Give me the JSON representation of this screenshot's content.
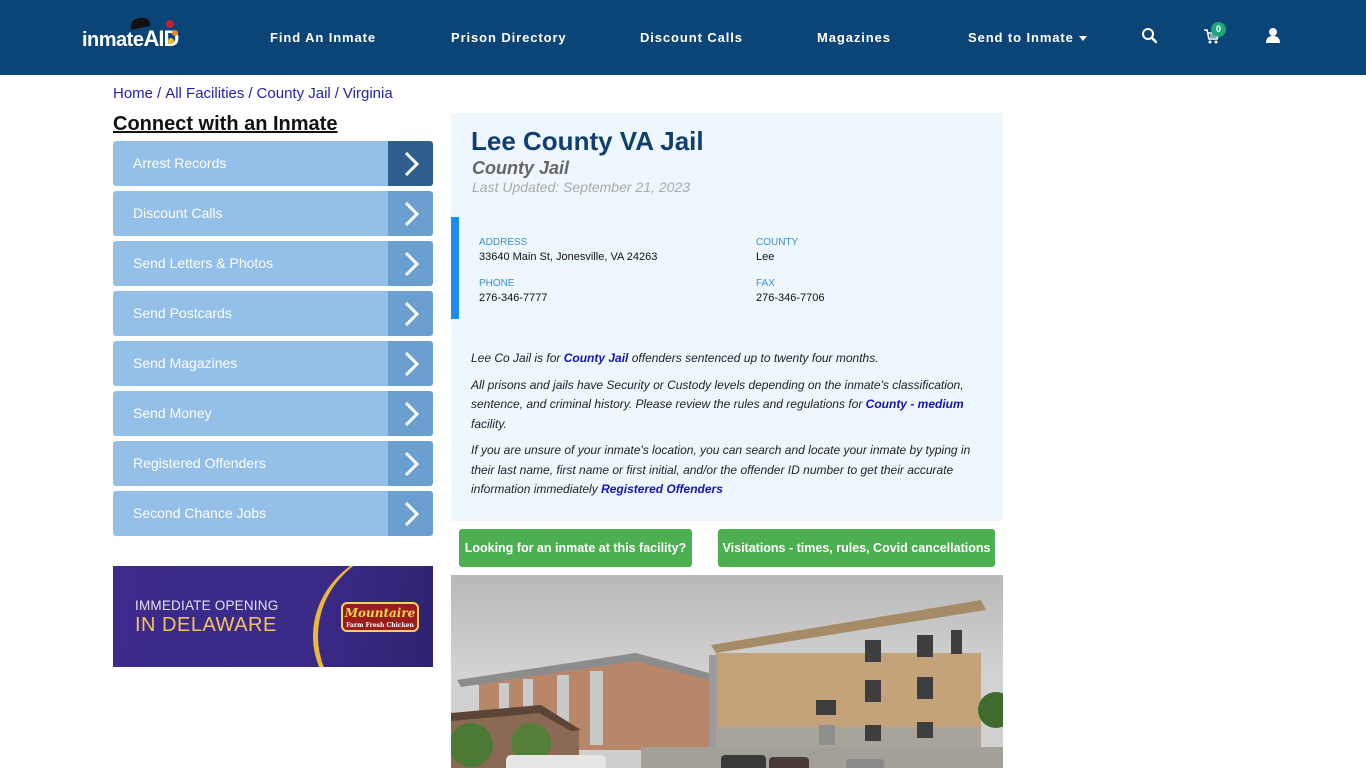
{
  "header": {
    "logo": {
      "part1": "inmate",
      "part2": "AID"
    },
    "nav": [
      {
        "label": "Find An Inmate"
      },
      {
        "label": "Prison Directory"
      },
      {
        "label": "Discount Calls"
      },
      {
        "label": "Magazines"
      },
      {
        "label": "Send to Inmate",
        "has_dropdown": true
      }
    ],
    "icons": {
      "search": "search-icon",
      "cart": "cart-icon",
      "user": "user-icon"
    },
    "cart_count": "0"
  },
  "breadcrumb": [
    {
      "label": "Home"
    },
    {
      "label": "All Facilities"
    },
    {
      "label": "County Jail"
    },
    {
      "label": "Virginia"
    }
  ],
  "breadcrumb_sep": "/",
  "sidebar": {
    "title": "Connect with an Inmate",
    "items": [
      {
        "label": "Arrest Records",
        "active": true
      },
      {
        "label": "Discount Calls"
      },
      {
        "label": "Send Letters & Photos"
      },
      {
        "label": "Send Postcards"
      },
      {
        "label": "Send Magazines"
      },
      {
        "label": "Send Money"
      },
      {
        "label": "Registered Offenders"
      },
      {
        "label": "Second Chance Jobs"
      }
    ],
    "ad": {
      "line1": "IMMEDIATE OPENING",
      "line2": "IN DELAWARE",
      "brand": "Mountaire",
      "brand_tagline": "Farm Fresh Chicken"
    }
  },
  "facility": {
    "name": "Lee County VA Jail",
    "type": "County Jail",
    "last_updated": "Last Updated: September 21, 2023",
    "address_label": "ADDRESS",
    "address": "33640 Main St, Jonesville, VA 24263",
    "county_label": "COUNTY",
    "county": "Lee",
    "phone_label": "PHONE",
    "phone": "276-346-7777",
    "fax_label": "FAX",
    "fax": "276-346-7706",
    "description": {
      "p1_pre": "Lee Co Jail is for ",
      "p1_link": "County Jail",
      "p1_post": " offenders sentenced up to twenty four months.",
      "p2_pre": "All prisons and jails have Security or Custody levels depending on the inmate's classification, sentence, and criminal history. Please review the rules and regulations for ",
      "p2_link": "County - medium",
      "p2_post": " facility.",
      "p3_pre": "If you are unsure of your inmate's location, you can search and locate your inmate by typing in their last name, first name or first initial, and/or the offender ID number to get their accurate information immediately ",
      "p3_link": "Registered Offenders"
    },
    "buttons": {
      "find_inmate": "Looking for an inmate at this facility?",
      "visitations": "Visitations - times, rules, Covid cancellations"
    },
    "photo_alt": "Lee County VA Jail building photo"
  },
  "colors": {
    "header_bg": "#0b4477",
    "sidebar_item": "#93bfe8",
    "sidebar_arrow": "#6a9fd0",
    "sidebar_arrow_active": "#2e5f8f",
    "card_bg": "#eef7fd",
    "accent_bar": "#1a8ef0",
    "button_green": "#4caf50",
    "title_blue": "#0f3f70",
    "link_blue": "#1414b8"
  }
}
